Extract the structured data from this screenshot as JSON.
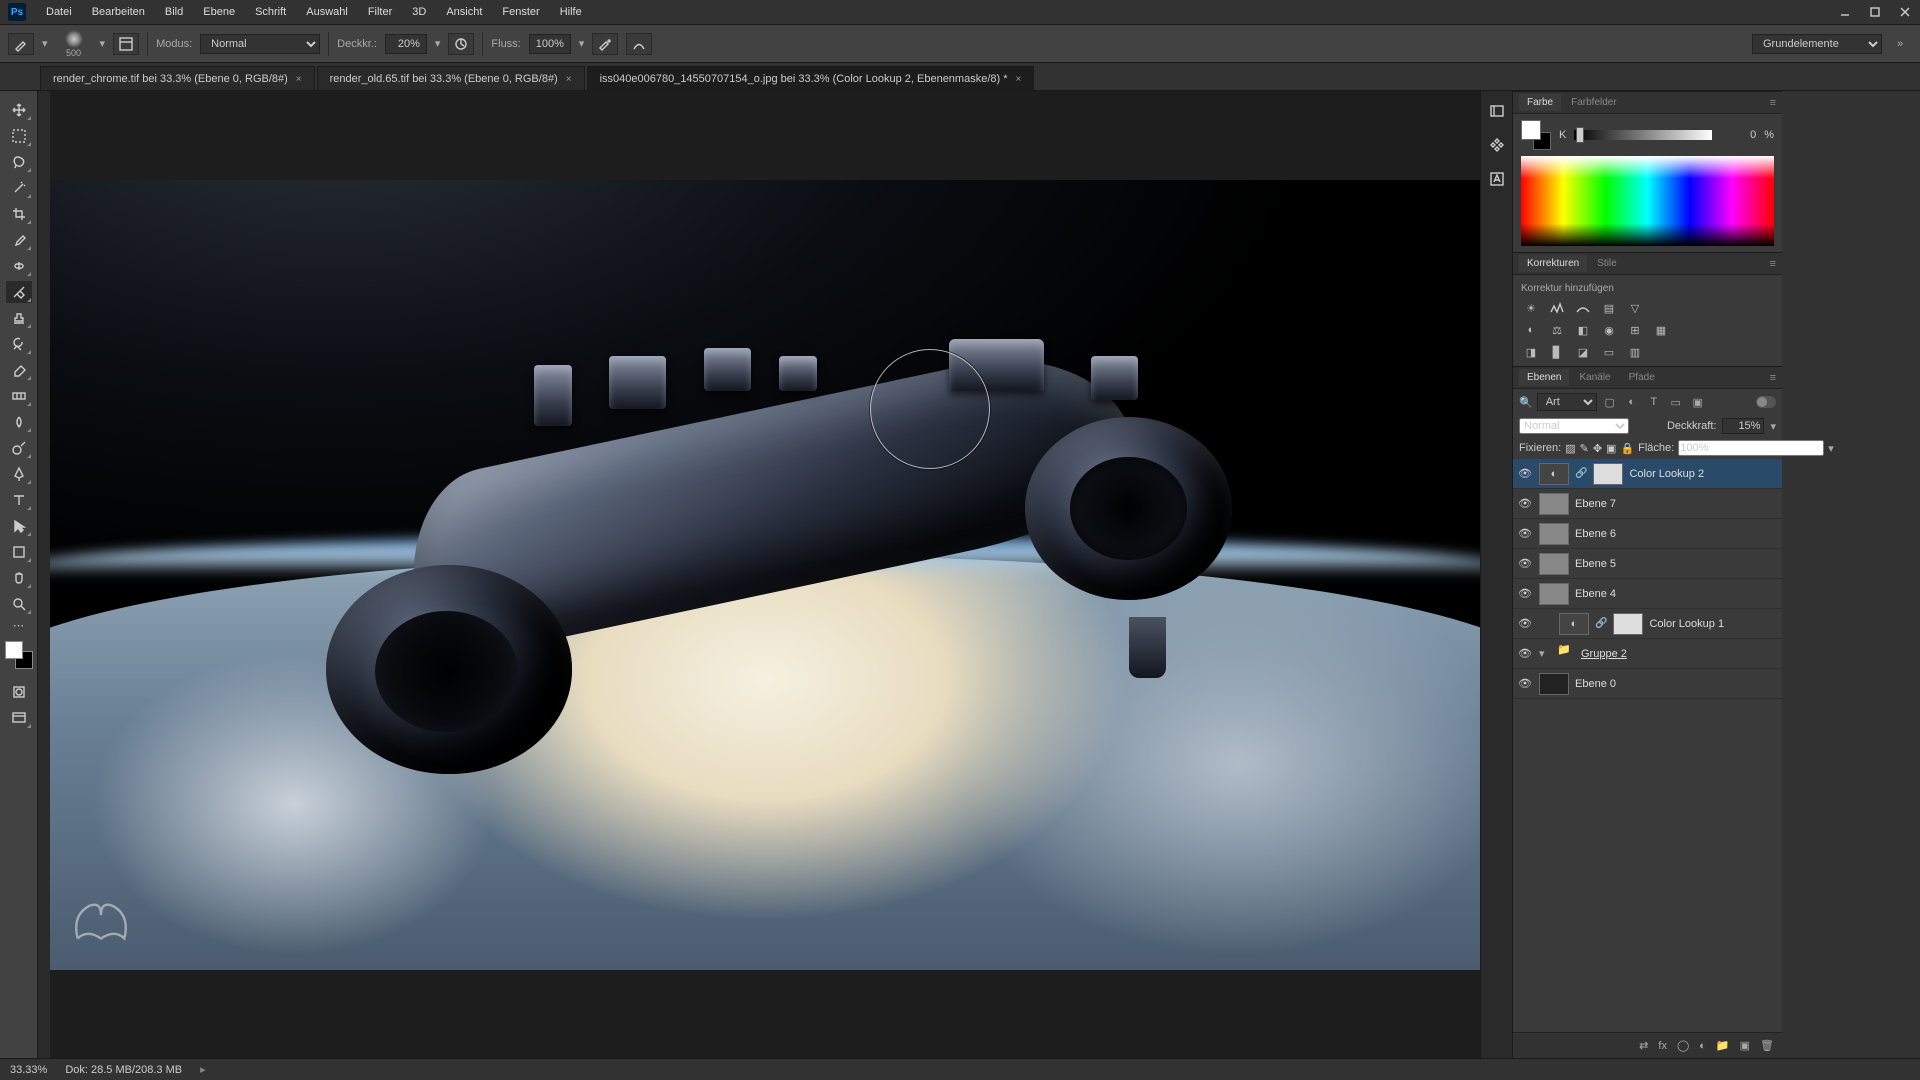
{
  "menu": {
    "items": [
      "Datei",
      "Bearbeiten",
      "Bild",
      "Ebene",
      "Schrift",
      "Auswahl",
      "Filter",
      "3D",
      "Ansicht",
      "Fenster",
      "Hilfe"
    ]
  },
  "optbar": {
    "brush_size": "500",
    "modus_label": "Modus:",
    "modus_value": "Normal",
    "deckkr_label": "Deckkr.:",
    "deckkr_value": "20%",
    "fluss_label": "Fluss:",
    "fluss_value": "100%",
    "right_label": "Grundelemente"
  },
  "tabs": [
    {
      "title": "render_chrome.tif bei 33.3% (Ebene 0, RGB/8#)",
      "active": false
    },
    {
      "title": "render_old.65.tif bei 33.3% (Ebene 0, RGB/8#)",
      "active": false
    },
    {
      "title": "iss040e006780_14550707154_o.jpg bei 33.3%  (Color Lookup 2, Ebenenmaske/8) *",
      "active": true
    }
  ],
  "color_panel": {
    "tabs": [
      "Farbe",
      "Farbfelder"
    ],
    "channel": "K",
    "value": "0",
    "unit": "%"
  },
  "adjust_panel": {
    "tabs": [
      "Korrekturen",
      "Stile"
    ],
    "hint": "Korrektur hinzufügen"
  },
  "layers_panel": {
    "tabs": [
      "Ebenen",
      "Kanäle",
      "Pfade"
    ],
    "filter_label": "Art",
    "blend": "Normal",
    "opacity_label": "Deckkraft:",
    "opacity": "15%",
    "fix_label": "Fixieren:",
    "fill_label": "Fläche:",
    "fill": "100%",
    "layers": [
      {
        "type": "adj",
        "name": "Color Lookup 2",
        "selected": true,
        "mask": true
      },
      {
        "type": "pixel",
        "name": "Ebene 7"
      },
      {
        "type": "pixel",
        "name": "Ebene 6"
      },
      {
        "type": "pixel",
        "name": "Ebene 5"
      },
      {
        "type": "pixel",
        "name": "Ebene 4"
      },
      {
        "type": "adj",
        "name": "Color Lookup 1",
        "mask": true,
        "indent": true
      },
      {
        "type": "group",
        "name": "Gruppe 2",
        "expanded": true
      },
      {
        "type": "pixel",
        "name": "Ebene 0",
        "dark": true
      }
    ]
  },
  "status": {
    "zoom": "33.33%",
    "doc": "Dok: 28.5 MB/208.3 MB"
  }
}
